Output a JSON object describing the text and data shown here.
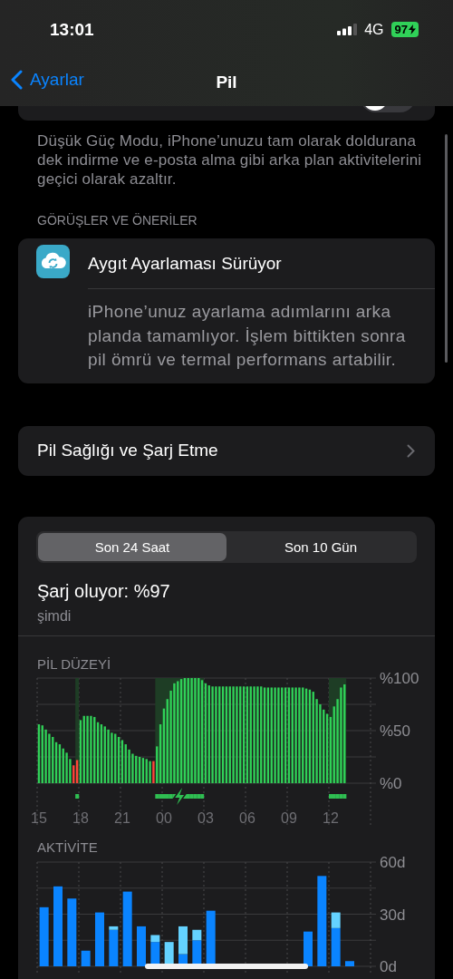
{
  "status_bar": {
    "time": "13:01",
    "network": "4G",
    "battery": "97"
  },
  "nav": {
    "back": "Ayarlar",
    "title": "Pil"
  },
  "low_power_toggle": {
    "on": false
  },
  "low_power_note": "Düşük Güç Modu, iPhone’unuzu tam olarak doldurana dek indirme ve e-posta alma gibi arka plan aktivitelerini geçici olarak azaltır.",
  "insights": {
    "header": "GÖRÜŞLER VE ÖNERİLER",
    "title": "Aygıt Ayarlaması Sürüyor",
    "text": "iPhone’unuz ayarlama adımlarını arka planda tamamlıyor. İşlem bittikten sonra pil ömrü ve termal performans artabilir."
  },
  "health_row": {
    "label": "Pil Sağlığı ve Şarj Etme"
  },
  "usage": {
    "segments": [
      {
        "label": "Son 24 Saat",
        "selected": true
      },
      {
        "label": "Son 10 Gün",
        "selected": false
      }
    ],
    "status": "Şarj oluyor: %97",
    "time": "şimdi",
    "battery_level": {
      "title": "PİL DÜZEYİ",
      "chart_data": {
        "type": "bar",
        "ylim": [
          0,
          100
        ],
        "yticks": [
          {
            "value": 0,
            "label": "%0"
          },
          {
            "value": 50,
            "label": "%50"
          },
          {
            "value": 100,
            "label": "%100"
          }
        ],
        "categories": [
          "15",
          null,
          null,
          null,
          null,
          null,
          null,
          null,
          null,
          null,
          null,
          null,
          "18",
          null,
          null,
          null,
          null,
          null,
          null,
          null,
          null,
          null,
          null,
          null,
          "21",
          null,
          null,
          null,
          null,
          null,
          null,
          null,
          null,
          null,
          null,
          null,
          "00",
          null,
          null,
          null,
          null,
          null,
          null,
          null,
          null,
          null,
          null,
          null,
          "03",
          null,
          null,
          null,
          null,
          null,
          null,
          null,
          null,
          null,
          null,
          null,
          "06",
          null,
          null,
          null,
          null,
          null,
          null,
          null,
          null,
          null,
          null,
          null,
          "09",
          null,
          null,
          null,
          null,
          null,
          null,
          null,
          null,
          null,
          null,
          null,
          "12",
          null,
          null,
          null,
          null
        ],
        "series": [
          {
            "color": "#30d158",
            "values": [
              56,
              55,
              51,
              47,
              44,
              39,
              37,
              33,
              29,
              23,
              null,
              null,
              60,
              64,
              64,
              64,
              63,
              58,
              56,
              54,
              51,
              48,
              47,
              44,
              41,
              37,
              32,
              28,
              26,
              25,
              24,
              23,
              21,
              null,
              35,
              56,
              71,
              80,
              88,
              95,
              97,
              99,
              100,
              100,
              100,
              100,
              100,
              98,
              95,
              93,
              92,
              92,
              92,
              92,
              92,
              92,
              92,
              92,
              92,
              92,
              92,
              92,
              92,
              92,
              92,
              91,
              91,
              91,
              91,
              91,
              91,
              91,
              91,
              91,
              91,
              91,
              91,
              90,
              89,
              87,
              80,
              75,
              70,
              66,
              63,
              73,
              80,
              91,
              94
            ]
          },
          {
            "color": "#ff453a",
            "values": [
              null,
              null,
              null,
              null,
              null,
              null,
              null,
              null,
              null,
              null,
              17,
              22,
              null,
              null,
              null,
              null,
              null,
              null,
              null,
              null,
              null,
              null,
              null,
              null,
              null,
              null,
              null,
              null,
              null,
              null,
              null,
              null,
              null,
              21,
              null,
              null,
              null,
              null,
              null,
              null,
              null,
              null,
              null,
              null,
              null,
              null,
              null,
              null,
              null,
              null,
              null,
              null,
              null,
              null,
              null,
              null,
              null,
              null,
              null,
              null,
              null,
              null,
              null,
              null,
              null,
              null,
              null,
              null,
              null,
              null,
              null,
              null,
              null,
              null,
              null,
              null,
              null,
              null,
              null,
              null,
              null,
              null,
              null,
              null,
              null,
              null,
              null,
              null,
              null
            ]
          }
        ]
      },
      "charging": [
        false,
        false,
        false,
        false,
        false,
        false,
        false,
        false,
        false,
        false,
        false,
        true,
        false,
        false,
        false,
        false,
        false,
        false,
        false,
        false,
        false,
        false,
        false,
        false,
        false,
        false,
        false,
        false,
        false,
        false,
        false,
        false,
        false,
        false,
        true,
        true,
        true,
        true,
        true,
        true,
        true,
        true,
        true,
        true,
        true,
        true,
        true,
        true,
        false,
        false,
        false,
        false,
        false,
        false,
        false,
        false,
        false,
        false,
        false,
        false,
        false,
        false,
        false,
        false,
        false,
        false,
        false,
        false,
        false,
        false,
        false,
        false,
        false,
        false,
        false,
        false,
        false,
        false,
        false,
        false,
        false,
        false,
        false,
        false,
        true,
        true,
        true,
        true,
        true
      ]
    },
    "activity": {
      "title": "AKTİVİTE",
      "chart_data": {
        "type": "bar",
        "stacked": true,
        "ylim": [
          0,
          60
        ],
        "yticks": [
          {
            "value": 0,
            "label": "0d"
          },
          {
            "value": 30,
            "label": "30d"
          },
          {
            "value": 60,
            "label": "60d"
          }
        ],
        "categories": [
          null,
          null,
          null,
          null,
          null,
          null,
          null,
          null,
          null,
          null,
          null,
          null,
          null,
          null,
          null,
          null,
          null,
          null,
          null,
          null,
          null,
          null,
          null,
          null
        ],
        "series": [
          {
            "color": "#0a84ff",
            "values": [
              34,
              46,
              39,
              9,
              31,
              21,
              43,
              23,
              14,
              null,
              7,
              15,
              32,
              null,
              null,
              null,
              null,
              null,
              null,
              20,
              52,
              22,
              3,
              null
            ]
          },
          {
            "color": "#64d2ff",
            "values": [
              null,
              null,
              null,
              null,
              null,
              2,
              null,
              null,
              4,
              14,
              16,
              6,
              null,
              null,
              null,
              null,
              null,
              null,
              null,
              null,
              null,
              9,
              null,
              null
            ]
          }
        ]
      }
    }
  }
}
